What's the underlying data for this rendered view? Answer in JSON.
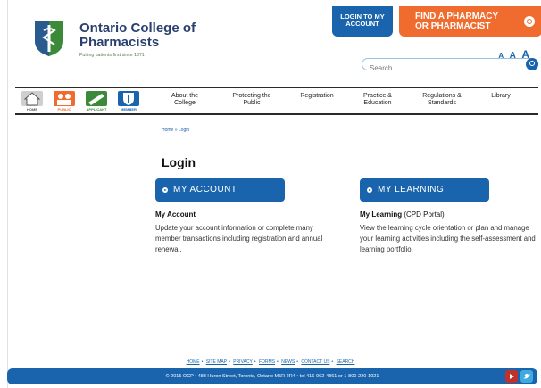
{
  "header": {
    "org_name": "Ontario College of Pharmacists",
    "tagline": "Putting patients first since 1871",
    "login_button": "LOGIN TO MY ACCOUNT",
    "find_button": "FIND A PHARMACY OR PHARMACIST",
    "search_placeholder": "Search",
    "text_size": [
      "A",
      "A",
      "A"
    ]
  },
  "nav": {
    "icons": [
      {
        "label": "HOME"
      },
      {
        "label": "PUBLIC"
      },
      {
        "label": "APPLICANT"
      },
      {
        "label": "MEMBER"
      }
    ],
    "links": [
      "About the College",
      "Protecting the Public",
      "Registration",
      "Practice & Education",
      "Regulations & Standards",
      "Library"
    ]
  },
  "breadcrumb": "Home » Login",
  "page_title": "Login",
  "cards": [
    {
      "button": "MY ACCOUNT",
      "heading": "My Account",
      "heading_suffix": "",
      "description": "Update your account information or complete many member transactions including registration and annual renewal."
    },
    {
      "button": "MY LEARNING",
      "heading": "My Learning",
      "heading_suffix": " (CPD Portal)",
      "description": "View the learning cycle orientation or plan and manage your learning activities including the self-assessment and learning portfolio."
    }
  ],
  "footer": {
    "links": [
      "HOME",
      "SITE MAP",
      "PRIVACY",
      "FORMS",
      "NEWS",
      "CONTACT US",
      "SEARCH"
    ],
    "address": "© 2015 OCP • 483 Huron Street, Toronto, Ontario M5R 2R4 • tel 416-962-4861 or 1-800-220-1921"
  },
  "colors": {
    "primary_blue": "#1a64ad",
    "orange": "#f06b2e",
    "logo_green": "#3b8a3a"
  }
}
